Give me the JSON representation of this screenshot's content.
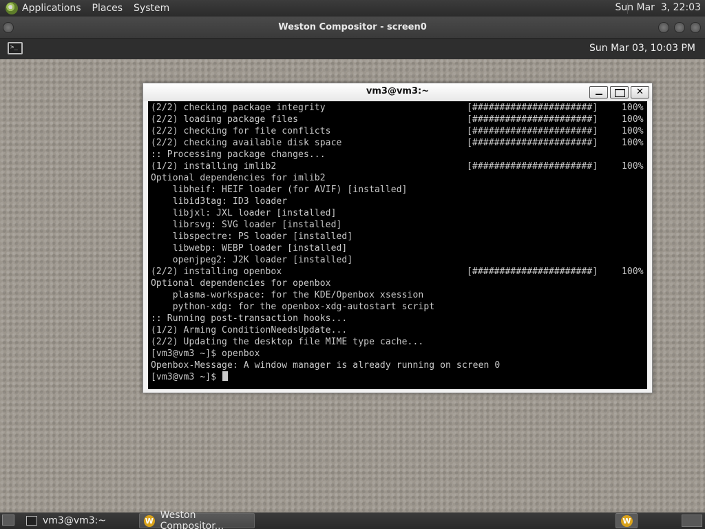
{
  "top_panel": {
    "menus": [
      "Applications",
      "Places",
      "System"
    ],
    "clock": "Sun Mar  3, 22:03"
  },
  "weston_window": {
    "title": "Weston Compositor - screen0"
  },
  "weston_panel": {
    "clock": "Sun Mar 03, 10:03 PM"
  },
  "terminal": {
    "title": "vm3@vm3:~",
    "buttons": {
      "close": "✕"
    },
    "lines": [
      {
        "text": "(2/2) checking package integrity",
        "progress": "[######################]",
        "pct": "100%"
      },
      {
        "text": "(2/2) loading package files",
        "progress": "[######################]",
        "pct": "100%"
      },
      {
        "text": "(2/2) checking for file conflicts",
        "progress": "[######################]",
        "pct": "100%"
      },
      {
        "text": "(2/2) checking available disk space",
        "progress": "[######################]",
        "pct": "100%"
      },
      {
        "text": ":: Processing package changes...",
        "progress": "",
        "pct": ""
      },
      {
        "text": "(1/2) installing imlib2",
        "progress": "[######################]",
        "pct": "100%"
      },
      {
        "text": "Optional dependencies for imlib2",
        "progress": "",
        "pct": ""
      },
      {
        "text": "    libheif: HEIF loader (for AVIF) [installed]",
        "progress": "",
        "pct": ""
      },
      {
        "text": "    libid3tag: ID3 loader",
        "progress": "",
        "pct": ""
      },
      {
        "text": "    libjxl: JXL loader [installed]",
        "progress": "",
        "pct": ""
      },
      {
        "text": "    librsvg: SVG loader [installed]",
        "progress": "",
        "pct": ""
      },
      {
        "text": "    libspectre: PS loader [installed]",
        "progress": "",
        "pct": ""
      },
      {
        "text": "    libwebp: WEBP loader [installed]",
        "progress": "",
        "pct": ""
      },
      {
        "text": "    openjpeg2: J2K loader [installed]",
        "progress": "",
        "pct": ""
      },
      {
        "text": "(2/2) installing openbox",
        "progress": "[######################]",
        "pct": "100%"
      },
      {
        "text": "Optional dependencies for openbox",
        "progress": "",
        "pct": ""
      },
      {
        "text": "    plasma-workspace: for the KDE/Openbox xsession",
        "progress": "",
        "pct": ""
      },
      {
        "text": "    python-xdg: for the openbox-xdg-autostart script",
        "progress": "",
        "pct": ""
      },
      {
        "text": ":: Running post-transaction hooks...",
        "progress": "",
        "pct": ""
      },
      {
        "text": "(1/2) Arming ConditionNeedsUpdate...",
        "progress": "",
        "pct": ""
      },
      {
        "text": "(2/2) Updating the desktop file MIME type cache...",
        "progress": "",
        "pct": ""
      },
      {
        "text": "[vm3@vm3 ~]$ openbox",
        "progress": "",
        "pct": ""
      },
      {
        "text": "Openbox-Message: A window manager is already running on screen 0",
        "progress": "",
        "pct": ""
      }
    ],
    "prompt": "[vm3@vm3 ~]$ "
  },
  "taskbar": {
    "tasks": [
      "vm3@vm3:~",
      "Weston Compositor..."
    ],
    "weston_icon_letter": "W"
  },
  "colors": {
    "terminal_bg": "#000000",
    "terminal_fg": "#c9c9c9",
    "weston_accent": "#d9a21b"
  }
}
